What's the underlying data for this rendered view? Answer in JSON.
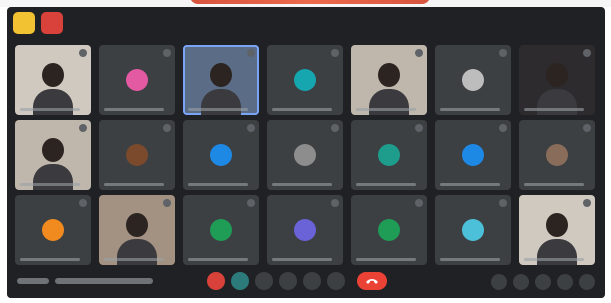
{
  "window": {
    "title": ""
  },
  "top_buttons": [
    {
      "label": "",
      "icon": "yellow-app-icon"
    },
    {
      "label": "",
      "icon": "red-close-icon"
    }
  ],
  "participants": [
    {
      "initial": "",
      "video": true,
      "class": "light"
    },
    {
      "initial": "",
      "video": false,
      "avatar_color": "#e35aa3"
    },
    {
      "initial": "",
      "video": true,
      "class": "bluewall active"
    },
    {
      "initial": "",
      "video": false,
      "avatar_color": "#15a6b0"
    },
    {
      "initial": "",
      "video": true,
      "class": "wall"
    },
    {
      "initial": "",
      "video": false,
      "avatar_color": "#bdbdbd"
    },
    {
      "initial": "",
      "video": true,
      "class": "dark"
    },
    {
      "initial": "",
      "video": true,
      "class": "wall"
    },
    {
      "initial": "",
      "video": false,
      "avatar_color": "#7b4a2d"
    },
    {
      "initial": "",
      "video": false,
      "avatar_color": "#1e88e5"
    },
    {
      "initial": "",
      "video": false,
      "avatar_color": "#8d8d8d"
    },
    {
      "initial": "",
      "video": false,
      "avatar_color": "#1e9c8c"
    },
    {
      "initial": "",
      "video": false,
      "avatar_color": "#1e88e5"
    },
    {
      "initial": "",
      "video": false,
      "avatar_color": "#8a6c5a"
    },
    {
      "initial": "",
      "video": false,
      "avatar_color": "#f18a1f"
    },
    {
      "initial": "",
      "video": true,
      "class": "warm"
    },
    {
      "initial": "",
      "video": false,
      "avatar_color": "#1f9c55"
    },
    {
      "initial": "",
      "video": false,
      "avatar_color": "#6a63d8"
    },
    {
      "initial": "",
      "video": false,
      "avatar_color": "#1f9c55"
    },
    {
      "initial": "",
      "video": false,
      "avatar_color": "#4cc0d9"
    },
    {
      "initial": "",
      "video": true,
      "class": "light"
    }
  ],
  "bottom": {
    "meeting_time": "",
    "meeting_code": ""
  },
  "controls": [
    {
      "icon": "mic-off-icon",
      "style": "red"
    },
    {
      "icon": "video-icon",
      "style": "teal"
    },
    {
      "icon": "captions-icon",
      "style": ""
    },
    {
      "icon": "hand-icon",
      "style": ""
    },
    {
      "icon": "present-icon",
      "style": ""
    },
    {
      "icon": "more-icon",
      "style": ""
    }
  ],
  "right_tools": [
    {
      "icon": "info-icon"
    },
    {
      "icon": "people-icon"
    },
    {
      "icon": "chat-icon"
    },
    {
      "icon": "activities-icon"
    },
    {
      "icon": "lock-icon"
    }
  ],
  "colors": {
    "background": "#202124",
    "tile": "#3c4043",
    "leave_button": "#ea4335",
    "mic_off": "#d9423a"
  }
}
